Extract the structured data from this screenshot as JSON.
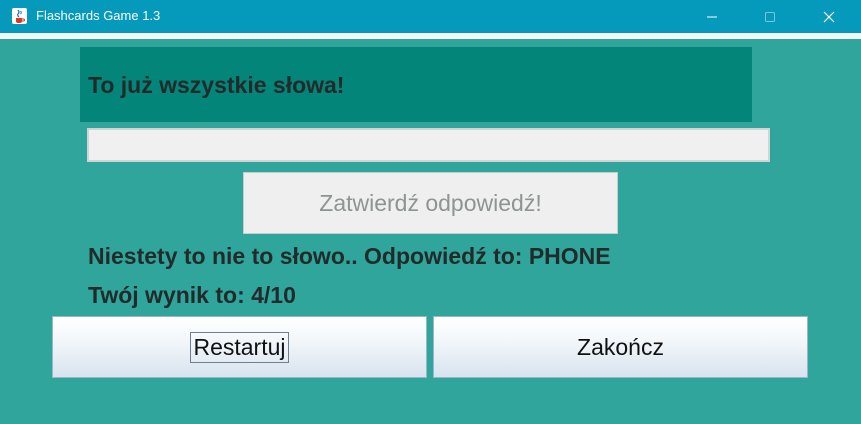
{
  "window": {
    "title": "Flashcards Game 1.3",
    "app_icon": "java-cup-icon",
    "controls": {
      "minimize_icon": "minimize-icon",
      "maximize_icon": "maximize-icon",
      "close_icon": "close-icon"
    }
  },
  "game": {
    "header_text": "To już wszystkie słowa!",
    "answer_input": {
      "value": "",
      "placeholder": ""
    },
    "confirm_label": "Zatwierdź odpowiedź!",
    "feedback_text": "Niestety to nie to słowo.. Odpowiedź to: PHONE",
    "score_text": "Twój wynik to: 4/10",
    "restart_label": "Restartuj",
    "quit_label": "Zakończ"
  },
  "colors": {
    "titlebar": "#0599bb",
    "background": "#2fa59c",
    "header_panel": "#03857a"
  }
}
